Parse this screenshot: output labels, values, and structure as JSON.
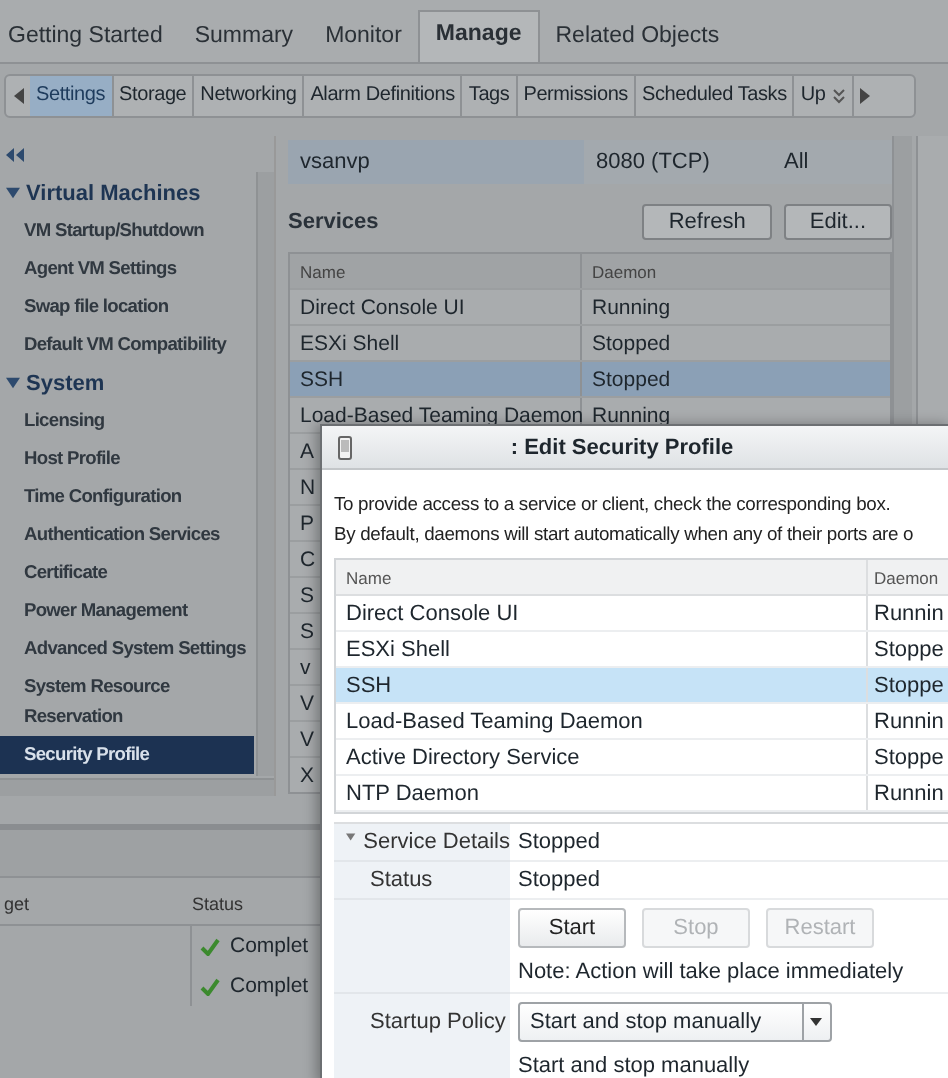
{
  "top_tabs": [
    {
      "label": "Getting Started",
      "selected": false
    },
    {
      "label": "Summary",
      "selected": false
    },
    {
      "label": "Monitor",
      "selected": false
    },
    {
      "label": "Manage",
      "selected": true
    },
    {
      "label": "Related Objects",
      "selected": false
    }
  ],
  "sub_tabs": [
    {
      "label": "Settings",
      "selected": true
    },
    {
      "label": "Storage",
      "selected": false
    },
    {
      "label": "Networking",
      "selected": false
    },
    {
      "label": "Alarm Definitions",
      "selected": false
    },
    {
      "label": "Tags",
      "selected": false
    },
    {
      "label": "Permissions",
      "selected": false
    },
    {
      "label": "Scheduled Tasks",
      "selected": false
    },
    {
      "label": "Up",
      "selected": false
    }
  ],
  "sidebar": {
    "groups": [
      {
        "label": "Virtual Machines",
        "expanded": true,
        "children": [
          {
            "label": "VM Startup/Shutdown",
            "selected": false
          },
          {
            "label": "Agent VM Settings",
            "selected": false
          },
          {
            "label": "Swap file location",
            "selected": false
          },
          {
            "label": "Default VM Compatibility",
            "selected": false
          }
        ]
      },
      {
        "label": "System",
        "expanded": true,
        "children": [
          {
            "label": "Licensing",
            "selected": false
          },
          {
            "label": "Host Profile",
            "selected": false
          },
          {
            "label": "Time Configuration",
            "selected": false
          },
          {
            "label": "Authentication Services",
            "selected": false
          },
          {
            "label": "Certificate",
            "selected": false
          },
          {
            "label": "Power Management",
            "selected": false
          },
          {
            "label": "Advanced System Settings",
            "selected": false
          },
          {
            "label": "System Resource Reservation",
            "selected": false
          },
          {
            "label": "Security Profile",
            "selected": true
          }
        ]
      }
    ]
  },
  "firewall_row": {
    "name": "vsanvp",
    "port": "8080 (TCP)",
    "column_3": "All"
  },
  "services": {
    "title": "Services",
    "buttons": [
      "Refresh",
      "Edit..."
    ],
    "columns": [
      "Name",
      "Daemon"
    ],
    "rows": [
      {
        "name": "Direct Console UI",
        "daemon": "Running",
        "selected": false
      },
      {
        "name": "ESXi Shell",
        "daemon": "Stopped",
        "selected": false
      },
      {
        "name": "SSH",
        "daemon": "Stopped",
        "selected": true
      },
      {
        "name": "Load-Based Teaming Daemon",
        "daemon": "Running",
        "selected": false
      },
      {
        "name": "A",
        "selected": false
      },
      {
        "name": "N",
        "selected": false
      },
      {
        "name": "P",
        "selected": false
      },
      {
        "name": "C",
        "selected": false
      },
      {
        "name": "S",
        "selected": false
      },
      {
        "name": "S",
        "selected": false
      },
      {
        "name": "v",
        "selected": false
      },
      {
        "name": "V",
        "selected": false
      },
      {
        "name": "V",
        "selected": false
      },
      {
        "name": "X",
        "selected": false
      }
    ]
  },
  "tasks": {
    "columns": [
      "get",
      "Status"
    ],
    "rows": [
      {
        "status": "Complet",
        "kind": "done"
      },
      {
        "status": "Complet",
        "kind": "done"
      }
    ]
  },
  "dialog": {
    "title": ": Edit Security Profile",
    "description": [
      "To provide access to a service or client, check the corresponding box.",
      "By default, daemons will start automatically when any of their ports are o"
    ],
    "columns": [
      "Name",
      "Daemon"
    ],
    "rows": [
      {
        "name": "Direct Console UI",
        "daemon": "Runnin",
        "selected": false
      },
      {
        "name": "ESXi Shell",
        "daemon": "Stoppe",
        "selected": false
      },
      {
        "name": "SSH",
        "daemon": "Stoppe",
        "selected": true
      },
      {
        "name": "Load-Based Teaming Daemon",
        "daemon": "Runnin",
        "selected": false
      },
      {
        "name": "Active Directory Service",
        "daemon": "Stoppe",
        "selected": false
      },
      {
        "name": "NTP Daemon",
        "daemon": "Runnin",
        "selected": false
      }
    ],
    "details": {
      "section": "Service Details",
      "expanded": true,
      "section_value": "Stopped",
      "status_label": "Status",
      "status": "Stopped",
      "buttons": [
        {
          "label": "Start",
          "disabled": false
        },
        {
          "label": "Stop",
          "disabled": true
        },
        {
          "label": "Restart",
          "disabled": true
        }
      ],
      "note": "Note: Action will take place immediately",
      "startup_label": "Startup Policy",
      "startup_value": "Start and stop manually",
      "startup_caption": "Start and stop manually"
    }
  }
}
